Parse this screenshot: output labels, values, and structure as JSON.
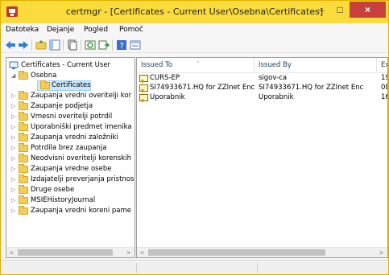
{
  "window": {
    "title": "certmgr - [Certificates - Current User\\Osebna\\Certificates]",
    "minimize_glyph": "–",
    "maximize_glyph": "□",
    "close_glyph": "×"
  },
  "menu": {
    "items": [
      "Datoteka",
      "Dejanje",
      "Pogled",
      "Pomoč"
    ]
  },
  "toolbar": {
    "icons": [
      "back-arrow-icon",
      "forward-arrow-icon",
      "up-folder-icon",
      "show-tree-icon",
      "copy-icon",
      "refresh-icon",
      "export-list-icon",
      "help-icon",
      "properties-icon"
    ]
  },
  "tree": {
    "root": "Certificates - Current User",
    "items": [
      {
        "label": "Osebna",
        "expanded": true
      },
      {
        "label": "Certificates",
        "selected": true
      },
      {
        "label": "Zaupanja vredni overitelji kor"
      },
      {
        "label": "Zaupanje podjetja"
      },
      {
        "label": "Vmesni overitelji potrdil"
      },
      {
        "label": "Uporabniški predmet imenika"
      },
      {
        "label": "Zaupanja vredni založniki"
      },
      {
        "label": "Potrdila brez zaupanja"
      },
      {
        "label": "Neodvisni overitelji korenskih"
      },
      {
        "label": "Zaupanja vredne osebe"
      },
      {
        "label": "Izdajatelji preverjanja pristnos"
      },
      {
        "label": "Druge osebe"
      },
      {
        "label": "MSIEHistoryJournal"
      },
      {
        "label": "Zaupanja vredni koreni pame"
      }
    ]
  },
  "list": {
    "columns": [
      "Issued To",
      "Issued By",
      "Ex"
    ],
    "rows": [
      {
        "issued_to": "CURS-EP",
        "issued_by": "sigov-ca",
        "expires": "19"
      },
      {
        "issued_to": "SI74933671.HQ for ZZInet Enc",
        "issued_by": "SI74933671.HQ for ZZInet Enc",
        "expires": "08"
      },
      {
        "issued_to": "Uporabnik",
        "issued_by": "Uporabnik",
        "expires": "16"
      }
    ]
  },
  "scroll": {
    "left_glyph": "<",
    "right_glyph": ">"
  },
  "colors": {
    "titlebar": "#fadb3c",
    "close_button": "#c7413a",
    "selection": "#cce8ff"
  }
}
